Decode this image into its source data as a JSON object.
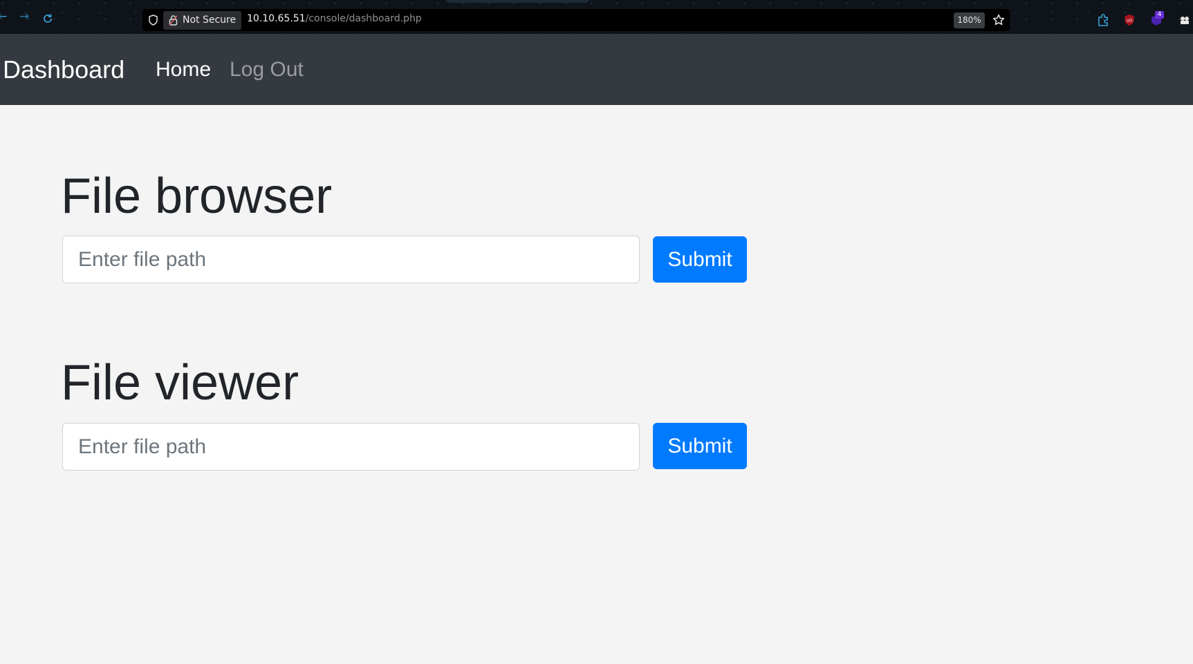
{
  "browser": {
    "security_label": "Not Secure",
    "url_host": "10.10.65.51",
    "url_path": "/console/dashboard.php",
    "zoom": "180%",
    "extension_badge_count": "4",
    "icons": [
      "back-arrow-icon",
      "forward-arrow-icon",
      "reload-icon",
      "shield-icon",
      "lock-icon",
      "star-icon",
      "extension-puzzle-icon",
      "ublock-icon",
      "notification-extension-icon",
      "extensions-menu-icon"
    ],
    "colors": {
      "chrome_bg": "#0f141a",
      "url_bar_bg": "#000000",
      "accent": "#3aa0d8"
    }
  },
  "navbar": {
    "brand": "Dashboard",
    "links": [
      {
        "label": "Home",
        "active": true
      },
      {
        "label": "Log Out",
        "active": false
      }
    ],
    "colors": {
      "bg": "#343a40",
      "active": "#ffffff",
      "inactive": "#9a9da1"
    }
  },
  "sections": [
    {
      "title": "File browser",
      "input_placeholder": "Enter file path",
      "input_value": "",
      "button_label": "Submit"
    },
    {
      "title": "File viewer",
      "input_placeholder": "Enter file path",
      "input_value": "",
      "button_label": "Submit"
    }
  ],
  "colors": {
    "page_bg": "#f4f4f4",
    "primary_button": "#007bff",
    "heading_text": "#212529"
  }
}
